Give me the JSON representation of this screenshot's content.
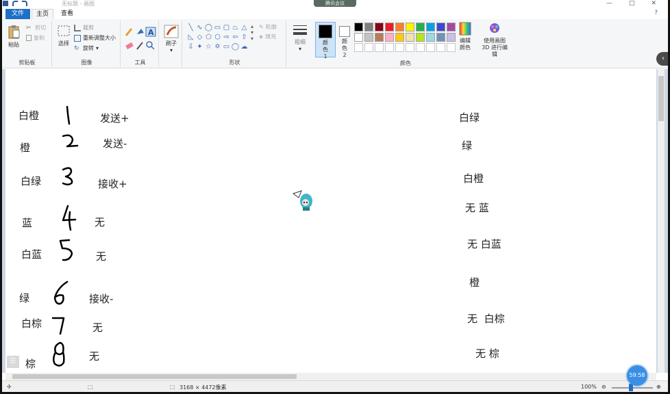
{
  "window": {
    "title": "无标题 - 画图",
    "meeting_pill": "腾讯会议",
    "min": "—",
    "max": "□",
    "close": "✕"
  },
  "tabs": [
    {
      "label": "文件"
    },
    {
      "label": "主页"
    },
    {
      "label": "查看"
    }
  ],
  "ribbon": {
    "clipboard": {
      "paste": "粘贴",
      "cut": "剪切",
      "copy": "复制",
      "group": "剪贴板"
    },
    "image": {
      "select": "选择",
      "crop": "裁剪",
      "resize": "重新调整大小",
      "rotate": "旋转",
      "group": "图像"
    },
    "tools": {
      "group": "工具"
    },
    "brush": {
      "label": "刷子"
    },
    "shapes": {
      "outline": "轮廓",
      "fill": "填充",
      "group": "形状"
    },
    "size": {
      "label": "粗细"
    },
    "color1": {
      "label": "颜色 1"
    },
    "color2": {
      "label": "颜色 2"
    },
    "colors_group": "颜色",
    "edit_colors": "编辑颜色",
    "paint3d": "使用画图 3D 进行编辑",
    "palette": [
      "#000000",
      "#7f7f7f",
      "#880015",
      "#ed1c24",
      "#ff7f27",
      "#fff200",
      "#22b14c",
      "#00a2e8",
      "#3f48cc",
      "#a349a4",
      "#ffffff",
      "#c3c3c3",
      "#b97a57",
      "#ffaec9",
      "#ffc90e",
      "#efe4b0",
      "#b5e61d",
      "#99d9ea",
      "#7092be",
      "#c8bfe7"
    ]
  },
  "canvas": {
    "left_rows": [
      {
        "color": "白橙",
        "signal": "发送+"
      },
      {
        "color": "橙",
        "signal": "发送-"
      },
      {
        "color": "白绿",
        "signal": "接收+"
      },
      {
        "color": "蓝",
        "signal": "无"
      },
      {
        "color": "白蓝",
        "signal": "无"
      },
      {
        "color": "绿",
        "signal": "接收-"
      },
      {
        "color": "白棕",
        "signal": "无"
      },
      {
        "color": "棕",
        "signal": "无"
      }
    ],
    "right_rows": [
      {
        "prefix": "",
        "color": "白绿"
      },
      {
        "prefix": "",
        "color": "绿"
      },
      {
        "prefix": "",
        "color": "白橙"
      },
      {
        "prefix": "无",
        "color": "蓝"
      },
      {
        "prefix": "无",
        "color": "白蓝"
      },
      {
        "prefix": "",
        "color": "橙"
      },
      {
        "prefix": "无",
        "color": "白棕"
      },
      {
        "prefix": "无",
        "color": "棕"
      }
    ]
  },
  "status": {
    "dimensions": "3168 × 4472像素",
    "zoom": "100%",
    "timer": "59:58"
  }
}
